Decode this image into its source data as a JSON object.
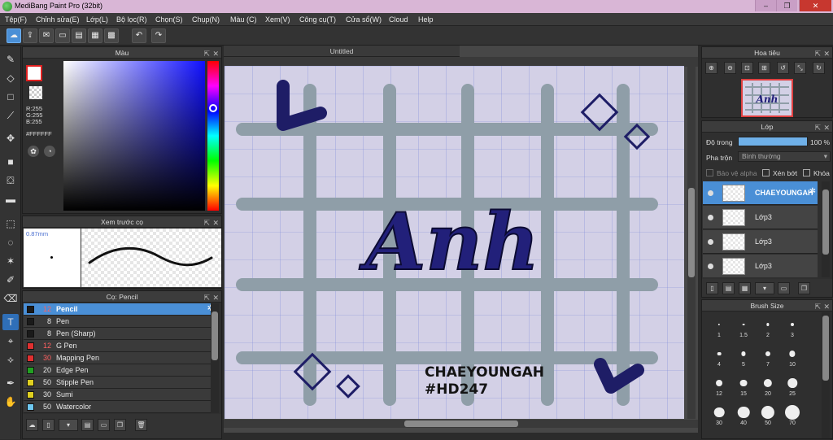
{
  "window": {
    "title": "MediBang Paint Pro (32bit)",
    "controls": [
      "–",
      "❐",
      "✕"
    ]
  },
  "menu": [
    "Tệp(F)",
    "Chỉnh sửa(E)",
    "Lớp(L)",
    "Bộ lọc(R)",
    "Chọn(S)",
    "Chụp(N)",
    "Màu (C)",
    "Xem(V)",
    "Công cụ(T)",
    "Cửa sổ(W)",
    "Cloud",
    "Help"
  ],
  "colors": {
    "accent": "#4a8fd6",
    "title_bar": "#d9b6d6",
    "canvas_bg": "#d3d0e6",
    "grid_stroke": "#8f9ea8",
    "ink_dark": "#1e1d66"
  },
  "color_panel": {
    "title": "Màu",
    "r": "R:255",
    "g": "G:255",
    "b": "B:255",
    "hex": "#FFFFFF"
  },
  "brush_preview": {
    "title": "Xem trước cọ",
    "size": "0.87mm"
  },
  "brush_panel": {
    "title": "Cọ: Pencil",
    "items": [
      {
        "size": "12",
        "name": "Pencil",
        "color": "#1a1a1a",
        "size_color": "#ff6060",
        "selected": true
      },
      {
        "size": "8",
        "name": "Pen",
        "color": "#1a1a1a"
      },
      {
        "size": "8",
        "name": "Pen (Sharp)",
        "color": "#1a1a1a"
      },
      {
        "size": "12",
        "name": "G Pen",
        "color": "#e03030",
        "size_color": "#ff6060"
      },
      {
        "size": "30",
        "name": "Mapping Pen",
        "color": "#e03030",
        "size_color": "#ff6060"
      },
      {
        "size": "20",
        "name": "Edge Pen",
        "color": "#22a022"
      },
      {
        "size": "50",
        "name": "Stipple Pen",
        "color": "#e0d020"
      },
      {
        "size": "30",
        "name": "Sumi",
        "color": "#e0d020"
      },
      {
        "size": "50",
        "name": "Watercolor",
        "color": "#6fc8f0"
      }
    ]
  },
  "canvas": {
    "tab": "Untitled",
    "title_text": "Anh",
    "caption_line1": "CHAEYOUNGAH",
    "caption_line2": "#HD247"
  },
  "navigator": {
    "title": "Hoa tiêu"
  },
  "layers": {
    "title": "Lớp",
    "opacity_label": "Độ trong",
    "opacity_value": "100 %",
    "blend_label": "Pha trộn",
    "blend_value": "Bình thường",
    "protect_alpha": "Bảo vệ alpha",
    "clip": "Xén bớt",
    "lock": "Khóa",
    "items": [
      {
        "name": "CHAEYOUNGAH",
        "selected": true
      },
      {
        "name": "Lớp3"
      },
      {
        "name": "Lớp3"
      },
      {
        "name": "Lớp3"
      }
    ]
  },
  "brush_size": {
    "title": "Brush Size",
    "sizes": [
      "1",
      "1.5",
      "2",
      "3",
      "4",
      "5",
      "7",
      "10",
      "12",
      "15",
      "20",
      "25",
      "30",
      "40",
      "50",
      "70"
    ]
  }
}
